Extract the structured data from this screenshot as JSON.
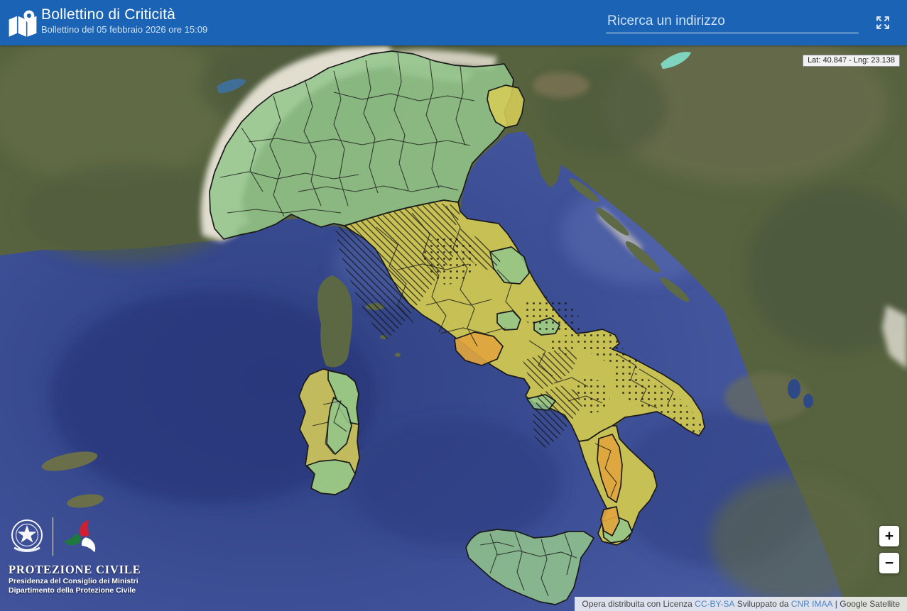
{
  "header": {
    "title": "Bollettino di Criticità",
    "subtitle": "Bollettino del 05 febbraio 2026 ore 15:09",
    "search_placeholder": "Ricerca un indirizzo"
  },
  "map": {
    "coordinates_badge": "Lat: 40.847 - Lng: 23.138",
    "base_layer": "Google Satellite",
    "legend": {
      "green_no_alert": "#93c78c",
      "yellow_alert": "#d7cd59",
      "orange_alert": "#e0a53e",
      "zone_border": "#1b1b1b",
      "patterns": [
        "diagonal-hatch",
        "dots"
      ]
    }
  },
  "colors": {
    "header_bg": "#1b63b4",
    "sea": "#4a5ca6"
  },
  "controls": {
    "zoom_in": "+",
    "zoom_out": "−"
  },
  "branding": {
    "org_name": "PROTEZIONE CIVILE",
    "org_line1": "Presidenza del Consiglio dei Ministri",
    "org_line2": "Dipartimento della Protezione Civile"
  },
  "attribution": {
    "text_prefix": "Opera distribuita con Licenza ",
    "license_link": "CC-BY-SA",
    "text_middle": " Sviluppato da ",
    "developer_link": "CNR IMAA",
    "separator": " | ",
    "base_layer": "Google Satellite"
  }
}
